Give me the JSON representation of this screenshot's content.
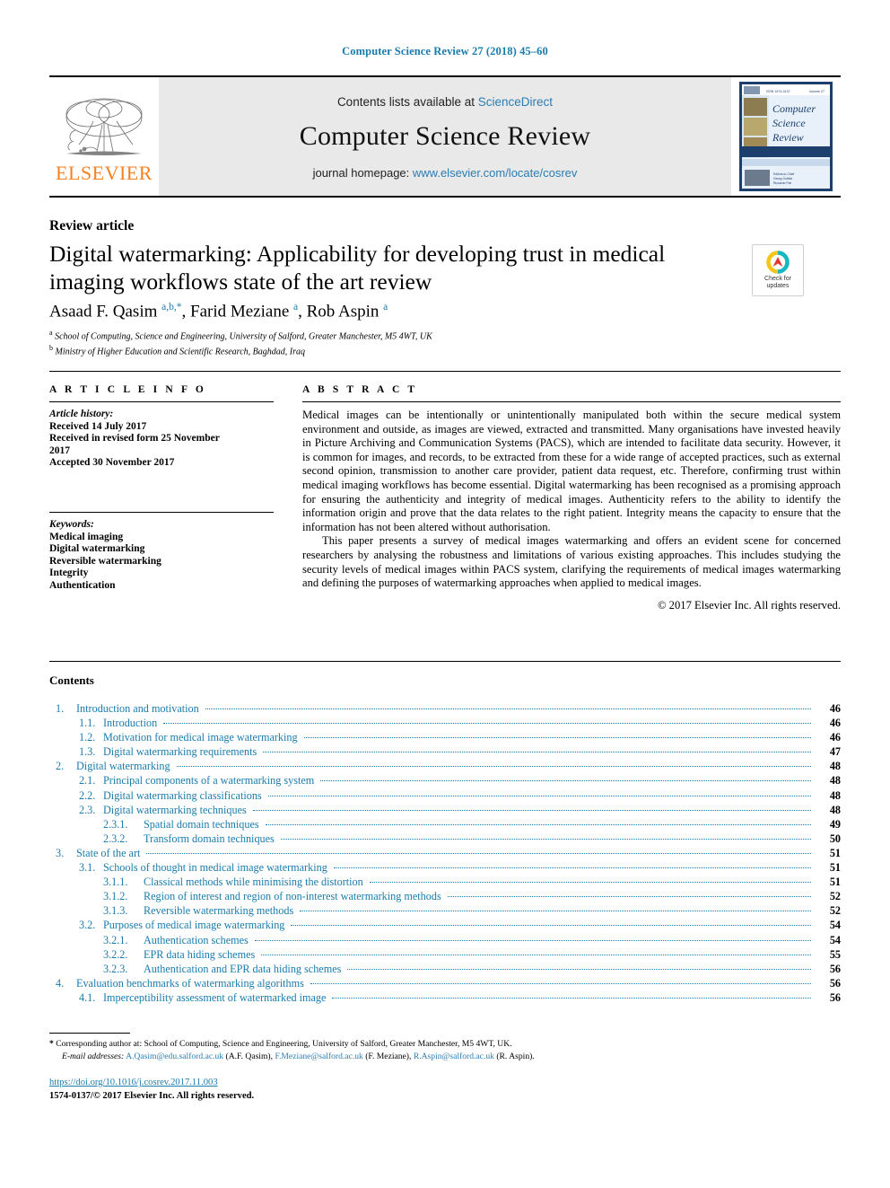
{
  "running_head": "Computer Science Review 27 (2018) 45–60",
  "masthead": {
    "contents_prefix": "Contents lists available at ",
    "sciencedirect": "ScienceDirect",
    "journal_title": "Computer Science Review",
    "homepage_prefix": "journal homepage: ",
    "homepage_url": "www.elsevier.com/locate/cosrev",
    "publisher": "ELSEVIER",
    "cover_title_line1": "Computer",
    "cover_title_line2": "Science",
    "cover_title_line3": "Review",
    "accent_color": "#2a7db5"
  },
  "crossmark": {
    "line1": "Check for",
    "line2": "updates"
  },
  "article": {
    "type": "Review article",
    "title": "Digital watermarking: Applicability for developing trust in medical imaging workflows state of the art review",
    "authors_html": "Asaad F. Qasim <sup>a,b,</sup><sup>*</sup>, Farid Meziane <sup>a</sup>, Rob Aspin <sup>a</sup>",
    "affiliations": [
      {
        "marker": "a",
        "text": "School of Computing, Science and Engineering, University of Salford, Greater Manchester, M5 4WT, UK"
      },
      {
        "marker": "b",
        "text": "Ministry of Higher Education and Scientific Research, Baghdad, Iraq"
      }
    ]
  },
  "article_info": {
    "heading": "A R T I C L E  I N F O",
    "history_label": "Article history:",
    "history": [
      "Received 14 July 2017",
      "Received in revised form 25 November",
      "2017",
      "Accepted 30 November 2017"
    ],
    "keywords_label": "Keywords:",
    "keywords": [
      "Medical imaging",
      "Digital watermarking",
      "Reversible watermarking",
      "Integrity",
      "Authentication"
    ]
  },
  "abstract": {
    "heading": "A B S T R A C T",
    "paragraph1": "Medical images can be intentionally or unintentionally manipulated both within the secure medical system environment and outside, as images are viewed, extracted and transmitted. Many organisations have invested heavily in Picture Archiving and Communication Systems (PACS), which are intended to facilitate data security. However, it is common for images, and records, to be extracted from these for a wide range of accepted practices, such as external second opinion, transmission to another care provider, patient data request, etc. Therefore, confirming trust within medical imaging workflows has become essential. Digital watermarking has been recognised as a promising approach for ensuring the authenticity and integrity of medical images. Authenticity refers to the ability to identify the information origin and prove that the data relates to the right patient. Integrity means the capacity to ensure that the information has not been altered without authorisation.",
    "paragraph2": "This paper presents a survey of medical images watermarking and offers an evident scene for concerned researchers by analysing the robustness and limitations of various existing approaches. This includes studying the security levels of medical images within PACS system, clarifying the requirements of medical images watermarking and defining the purposes of watermarking approaches when applied to medical images.",
    "copyright": "© 2017 Elsevier Inc. All rights reserved."
  },
  "contents": {
    "heading": "Contents",
    "entries": [
      {
        "level": 1,
        "num": "1.",
        "label": "Introduction and motivation",
        "page": "46"
      },
      {
        "level": 2,
        "num": "1.1.",
        "label": "Introduction",
        "page": "46"
      },
      {
        "level": 2,
        "num": "1.2.",
        "label": "Motivation for medical image watermarking",
        "page": "46"
      },
      {
        "level": 2,
        "num": "1.3.",
        "label": "Digital watermarking requirements",
        "page": "47"
      },
      {
        "level": 1,
        "num": "2.",
        "label": "Digital watermarking",
        "page": "48"
      },
      {
        "level": 2,
        "num": "2.1.",
        "label": "Principal components of a watermarking system",
        "page": "48"
      },
      {
        "level": 2,
        "num": "2.2.",
        "label": "Digital watermarking classifications",
        "page": "48"
      },
      {
        "level": 2,
        "num": "2.3.",
        "label": "Digital watermarking techniques",
        "page": "48"
      },
      {
        "level": 3,
        "num": "2.3.1.",
        "label": "Spatial domain techniques",
        "page": "49"
      },
      {
        "level": 3,
        "num": "2.3.2.",
        "label": "Transform domain techniques",
        "page": "50"
      },
      {
        "level": 1,
        "num": "3.",
        "label": "State of the art",
        "page": "51"
      },
      {
        "level": 2,
        "num": "3.1.",
        "label": "Schools of thought in medical image watermarking",
        "page": "51"
      },
      {
        "level": 3,
        "num": "3.1.1.",
        "label": "Classical methods while minimising the distortion",
        "page": "51"
      },
      {
        "level": 3,
        "num": "3.1.2.",
        "label": "Region of interest and region of non-interest watermarking methods",
        "page": "52"
      },
      {
        "level": 3,
        "num": "3.1.3.",
        "label": "Reversible watermarking methods",
        "page": "52"
      },
      {
        "level": 2,
        "num": "3.2.",
        "label": "Purposes of medical image watermarking",
        "page": "54"
      },
      {
        "level": 3,
        "num": "3.2.1.",
        "label": "Authentication schemes",
        "page": "54"
      },
      {
        "level": 3,
        "num": "3.2.2.",
        "label": "EPR data hiding schemes",
        "page": "55"
      },
      {
        "level": 3,
        "num": "3.2.3.",
        "label": "Authentication and EPR data hiding schemes",
        "page": "56"
      },
      {
        "level": 1,
        "num": "4.",
        "label": "Evaluation benchmarks of watermarking algorithms",
        "page": "56"
      },
      {
        "level": 2,
        "num": "4.1.",
        "label": "Imperceptibility assessment of watermarked image",
        "page": "56"
      }
    ]
  },
  "footnotes": {
    "corresponding": "Corresponding author at: School of Computing, Science and Engineering, University of Salford, Greater Manchester, M5 4WT, UK.",
    "email_label": "E-mail addresses:",
    "emails": [
      {
        "address": "A.Qasim@edu.salford.ac.uk",
        "who": "(A.F. Qasim),"
      },
      {
        "address": "F.Meziane@salford.ac.uk",
        "who": "(F. Meziane),"
      },
      {
        "address": "R.Aspin@salford.ac.uk",
        "who": "(R. Aspin)."
      }
    ],
    "doi": "https://doi.org/10.1016/j.cosrev.2017.11.003",
    "issn_line": "1574-0137/© 2017 Elsevier Inc. All rights reserved."
  }
}
